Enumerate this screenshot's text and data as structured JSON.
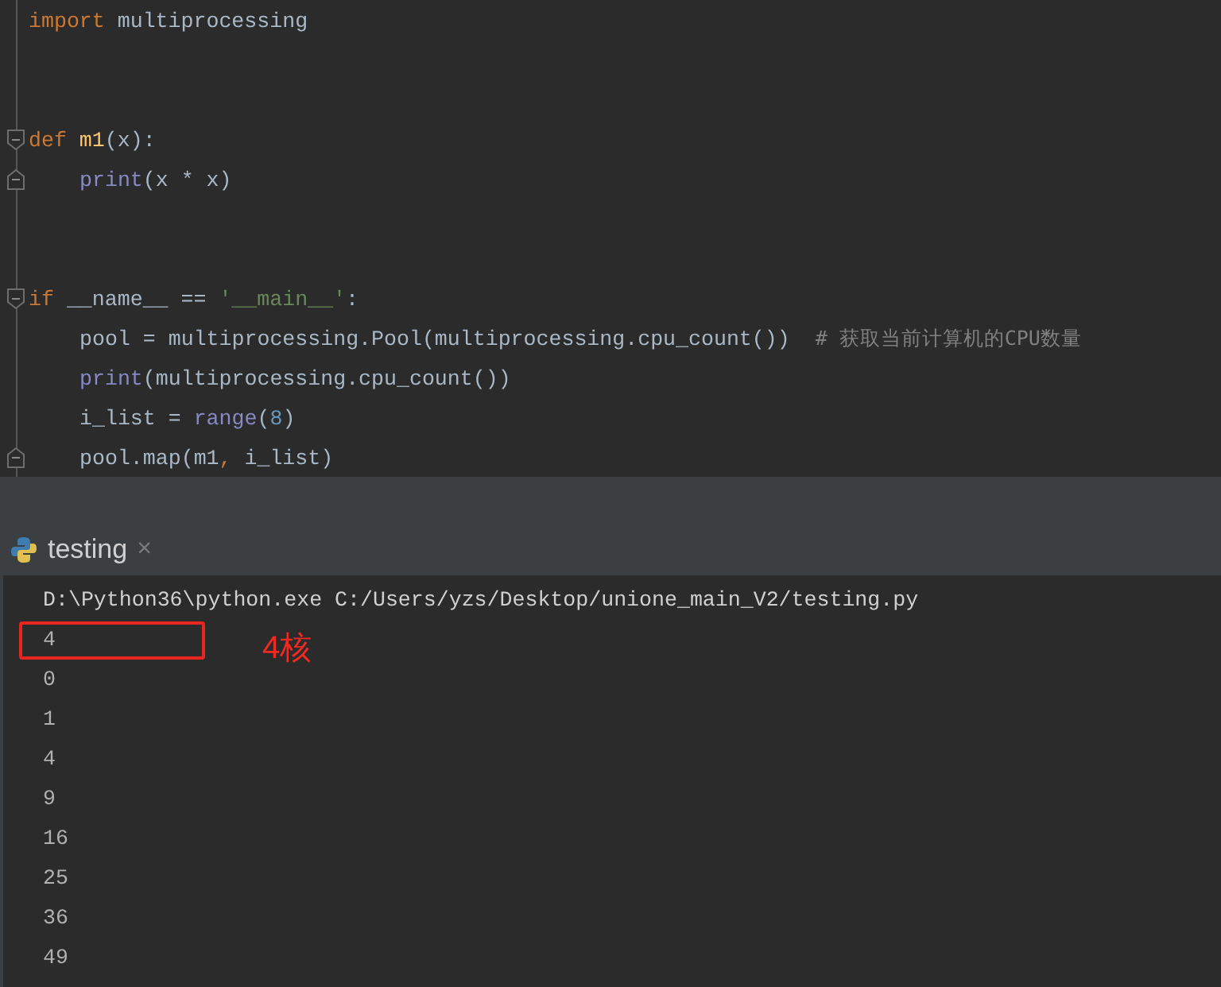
{
  "editor": {
    "lines": [
      {
        "kind": "code",
        "tokens": [
          {
            "kind": "keyword",
            "text": "import"
          },
          {
            "kind": "plain",
            "text": " multiprocessing"
          }
        ]
      },
      {
        "kind": "blank"
      },
      {
        "kind": "blank"
      },
      {
        "kind": "fold_start",
        "tokens": [
          {
            "kind": "keyword",
            "text": "def "
          },
          {
            "kind": "function",
            "text": "m1"
          },
          {
            "kind": "plain",
            "text": "(x):"
          }
        ],
        "children": [
          {
            "kind": "fold_end",
            "tokens": [
              {
                "kind": "builtin",
                "text": "print"
              },
              {
                "kind": "plain",
                "text": "(x * x)"
              }
            ]
          }
        ]
      },
      {
        "kind": "blank"
      },
      {
        "kind": "blank"
      },
      {
        "kind": "fold_start",
        "tokens": [
          {
            "kind": "keyword",
            "text": "if"
          },
          {
            "kind": "plain",
            "text": " __name__ == "
          },
          {
            "kind": "string",
            "text": "'__main__'"
          },
          {
            "kind": "plain",
            "text": ":"
          }
        ],
        "children": [
          {
            "kind": "code",
            "tokens": [
              {
                "kind": "plain",
                "text": "pool = multiprocessing.Pool(multiprocessing.cpu_count())  "
              },
              {
                "kind": "comment",
                "text": "# 获取当前计算机的CPU数量"
              }
            ]
          },
          {
            "kind": "code",
            "tokens": [
              {
                "kind": "builtin",
                "text": "print"
              },
              {
                "kind": "plain",
                "text": "(multiprocessing.cpu_count())"
              }
            ]
          },
          {
            "kind": "code",
            "tokens": [
              {
                "kind": "plain",
                "text": "i_list = "
              },
              {
                "kind": "builtin",
                "text": "range"
              },
              {
                "kind": "plain",
                "text": "("
              },
              {
                "kind": "number",
                "text": "8"
              },
              {
                "kind": "plain",
                "text": ")"
              }
            ]
          },
          {
            "kind": "fold_end",
            "tokens": [
              {
                "kind": "plain",
                "text": "pool.map(m1"
              },
              {
                "kind": "keyword",
                "text": ","
              },
              {
                "kind": "plain",
                "text": " i_list)"
              }
            ]
          }
        ]
      }
    ]
  },
  "run_panel": {
    "tab": {
      "label": "testing",
      "selected": true,
      "close": "×"
    },
    "output": [
      {
        "text": "D:\\Python36\\python.exe C:/Users/yzs/Desktop/unione_main_V2/testing.py",
        "highlighted": false
      },
      {
        "text": "4",
        "highlighted": true,
        "annotation": "4核"
      },
      {
        "text": "0",
        "highlighted": false
      },
      {
        "text": "1",
        "highlighted": false
      },
      {
        "text": "4",
        "highlighted": false
      },
      {
        "text": "9",
        "highlighted": false
      },
      {
        "text": "16",
        "highlighted": false
      },
      {
        "text": "25",
        "highlighted": false
      },
      {
        "text": "36",
        "highlighted": false
      },
      {
        "text": "49",
        "highlighted": false
      }
    ]
  }
}
